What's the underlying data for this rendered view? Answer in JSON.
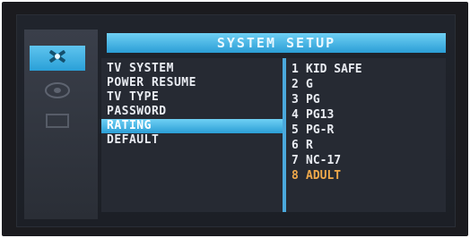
{
  "colors": {
    "accent": "#2b9ed6",
    "background": "#1f232b",
    "text": "#e9ecf2",
    "selected_option": "#f0a94a"
  },
  "title": "SYSTEM SETUP",
  "icons": [
    "setup-icon",
    "disc-icon",
    "tv-icon"
  ],
  "menu": {
    "items": [
      "TV SYSTEM",
      "POWER RESUME",
      "TV TYPE",
      "PASSWORD",
      "RATING",
      "DEFAULT"
    ],
    "selected": "RATING"
  },
  "rating_options": [
    {
      "num": "1",
      "label": "KID SAFE"
    },
    {
      "num": "2",
      "label": "G"
    },
    {
      "num": "3",
      "label": "PG"
    },
    {
      "num": "4",
      "label": "PG13"
    },
    {
      "num": "5",
      "label": "PG-R"
    },
    {
      "num": "6",
      "label": "R"
    },
    {
      "num": "7",
      "label": "NC-17"
    },
    {
      "num": "8",
      "label": "ADULT"
    }
  ],
  "current_rating": "8 ADULT"
}
